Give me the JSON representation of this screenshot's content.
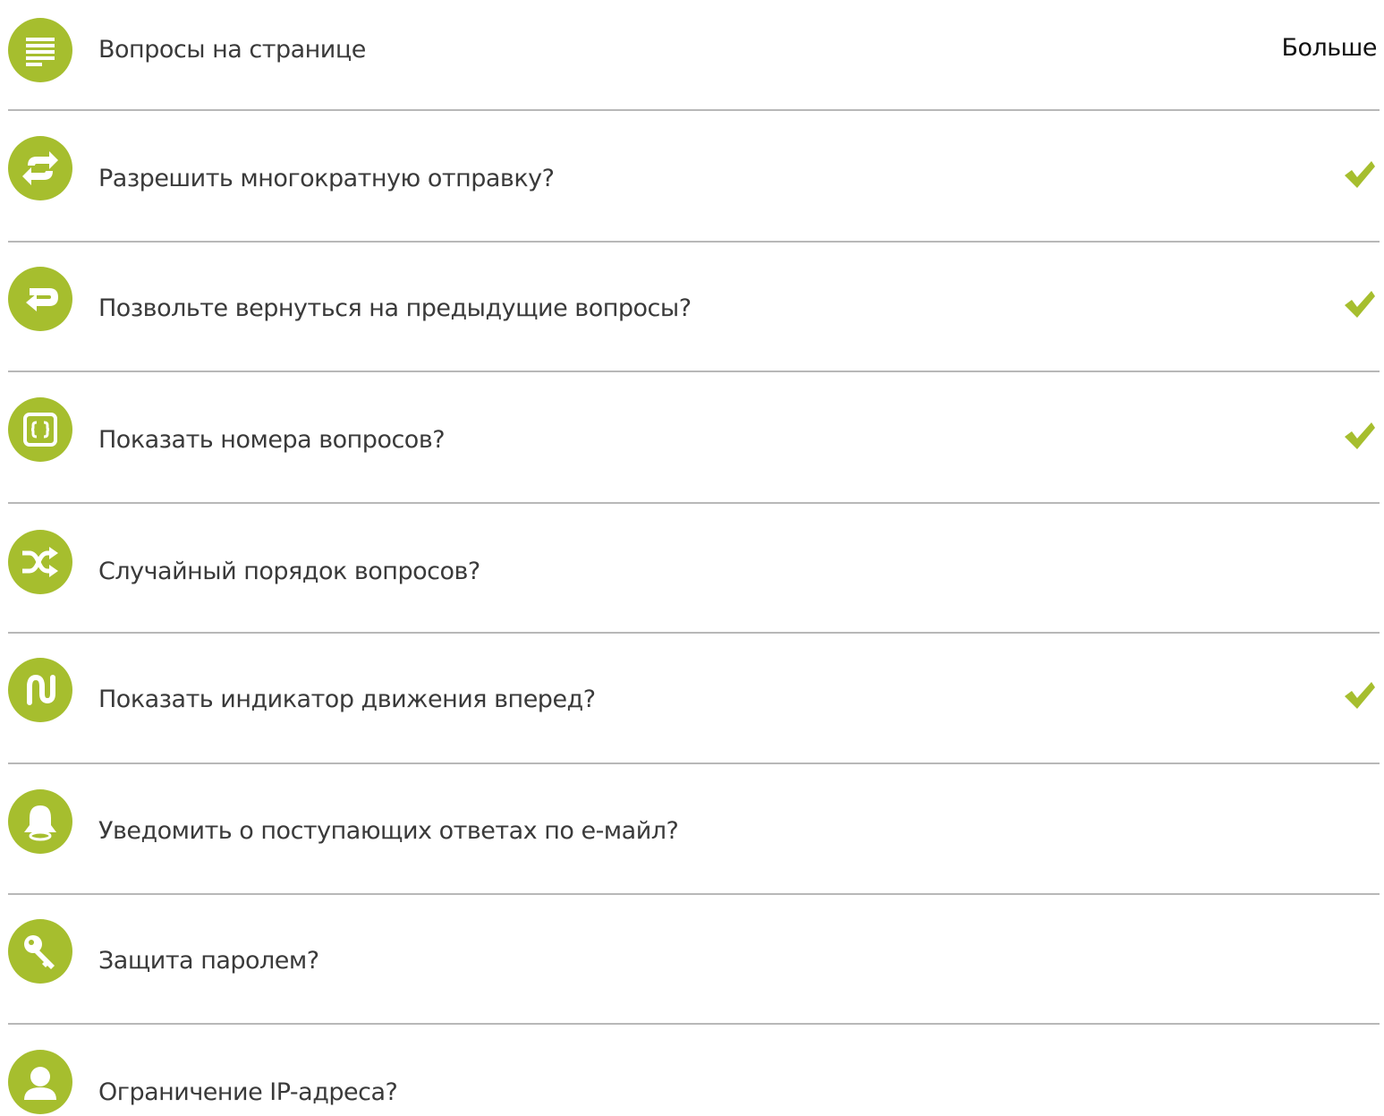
{
  "accent_color": "#a6be2e",
  "header": {
    "icon": "lines-icon",
    "label": "Вопросы на странице",
    "more_label": "Больше"
  },
  "settings": [
    {
      "icon": "refresh-arrows-icon",
      "label": "Разрешить многократную отправку?",
      "checked": true
    },
    {
      "icon": "return-arrow-icon",
      "label": "Позвольте вернуться на предыдущие вопросы?",
      "checked": true
    },
    {
      "icon": "braces-box-icon",
      "label": "Показать номера вопросов?",
      "checked": true
    },
    {
      "icon": "shuffle-icon",
      "label": "Случайный порядок вопросов?",
      "checked": false
    },
    {
      "icon": "progress-path-icon",
      "label": "Показать индикатор движения вперед?",
      "checked": true
    },
    {
      "icon": "bell-icon",
      "label": "Уведомить о поступающих ответах по е-майл?",
      "checked": false
    },
    {
      "icon": "key-icon",
      "label": "Защита паролем?",
      "checked": false
    },
    {
      "icon": "user-icon",
      "label": "Ограничение IP-адреса?",
      "checked": false
    }
  ]
}
